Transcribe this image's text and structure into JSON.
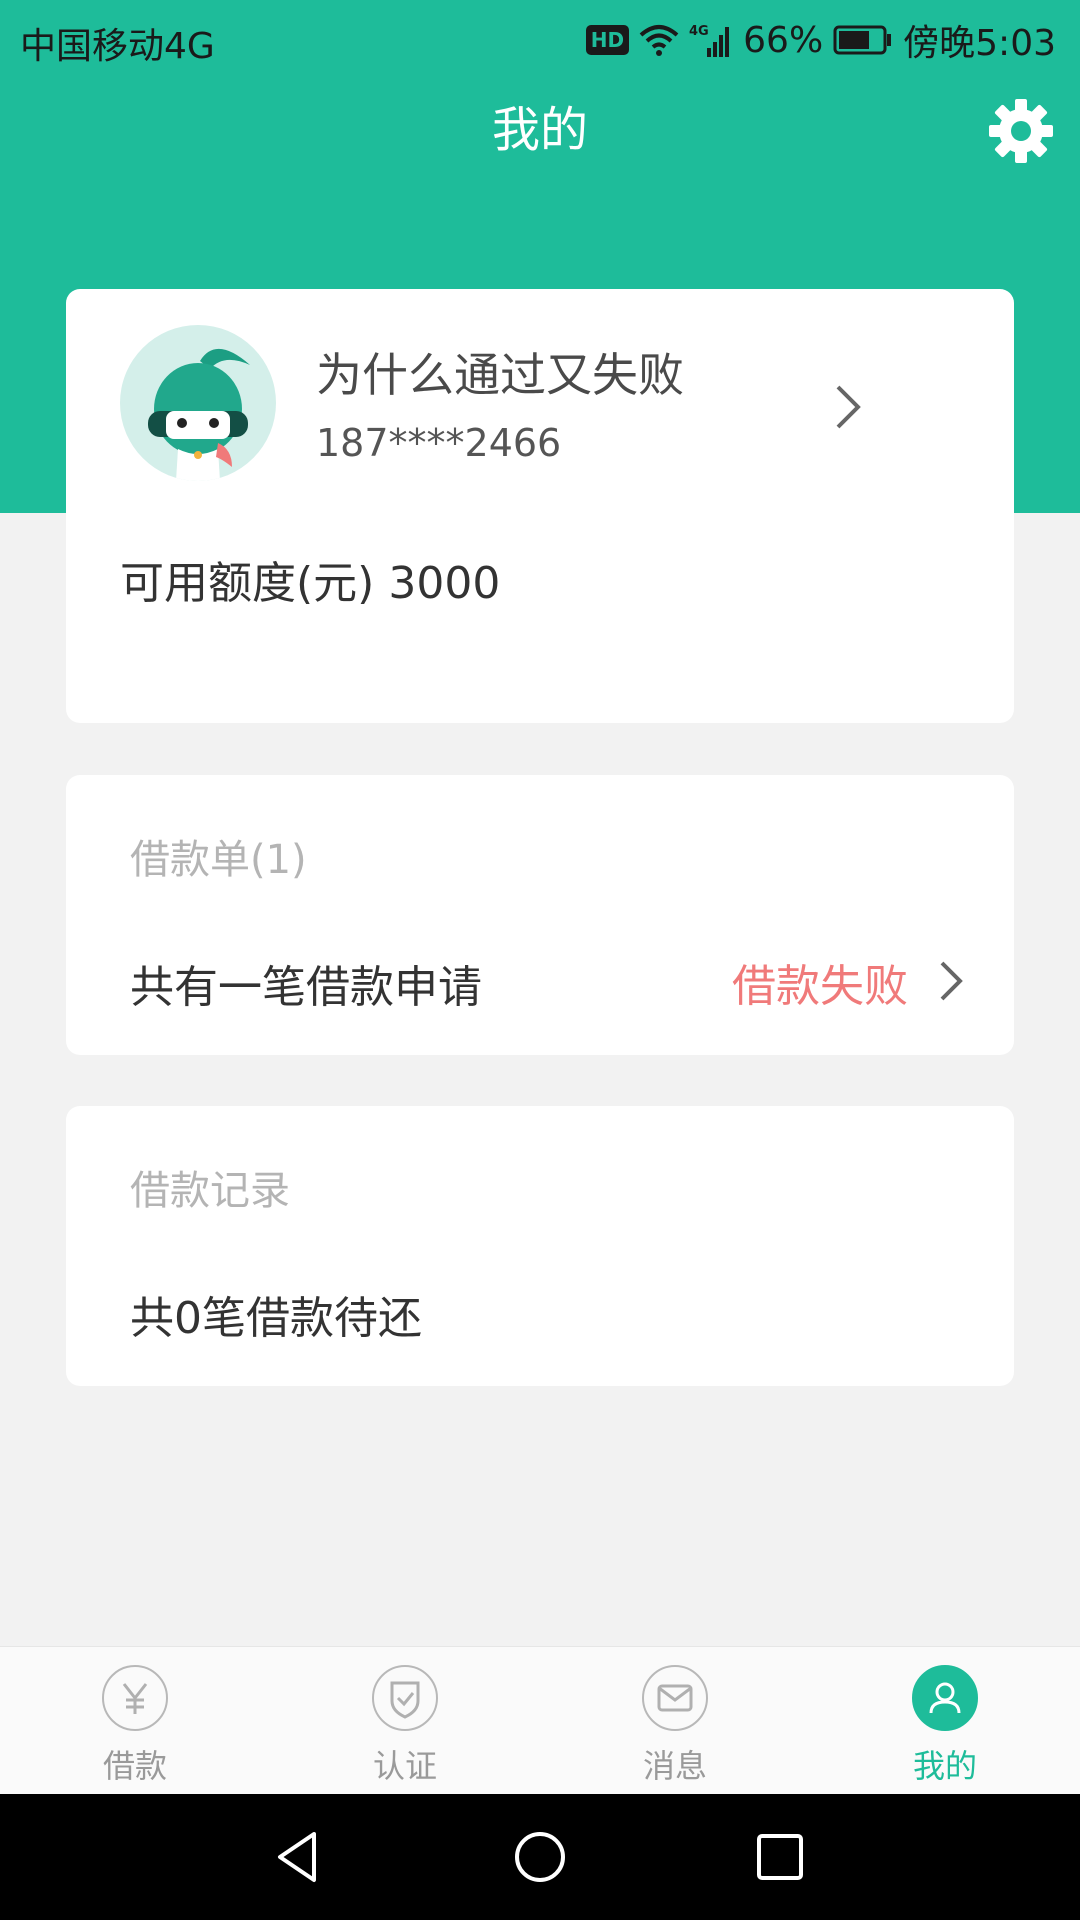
{
  "status_bar": {
    "carrier": "中国移动4G",
    "hd": "HD",
    "battery": "66%",
    "time": "傍晚5:03"
  },
  "header": {
    "title": "我的",
    "settings_icon": "gear-icon"
  },
  "profile": {
    "name": "为什么通过又失败",
    "phone": "187****2466",
    "credit_label": "可用额度(元)",
    "credit_value": "3000"
  },
  "loan_orders": {
    "heading": "借款单(1)",
    "summary": "共有一笔借款申请",
    "status": "借款失败"
  },
  "loan_records": {
    "heading": "借款记录",
    "summary": "共0笔借款待还"
  },
  "tabs": [
    {
      "label": "借款",
      "icon": "yen-icon"
    },
    {
      "label": "认证",
      "icon": "shield-check-icon"
    },
    {
      "label": "消息",
      "icon": "mail-icon"
    },
    {
      "label": "我的",
      "icon": "user-icon",
      "active": true
    }
  ],
  "colors": {
    "brand": "#1ebc9a",
    "status_fail": "#f07a7a",
    "page_bg": "#f2f2f2"
  }
}
